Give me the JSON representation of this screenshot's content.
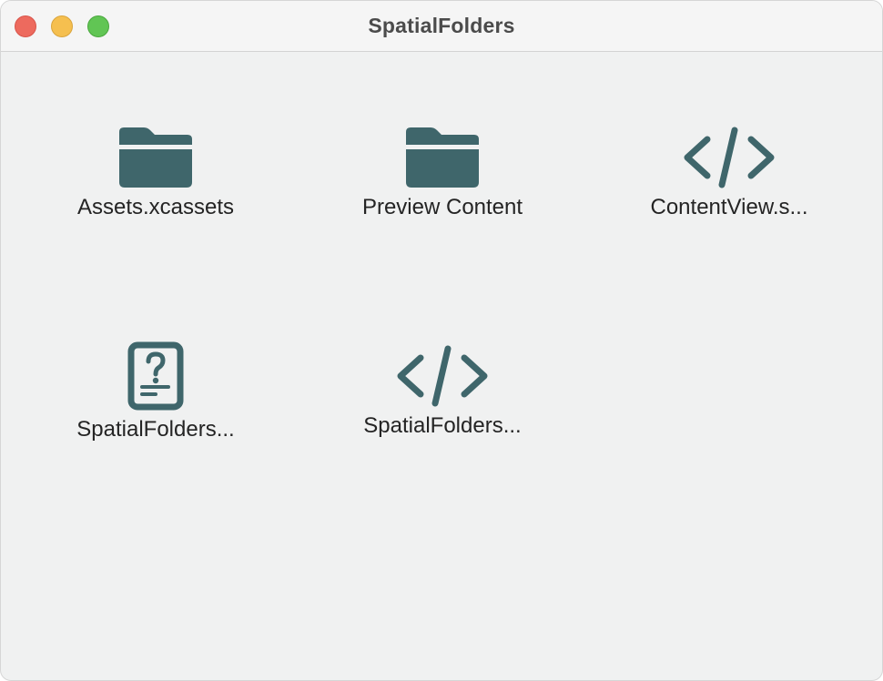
{
  "window": {
    "title": "SpatialFolders"
  },
  "colors": {
    "icon": "#3f666b",
    "background": "#f0f1f1"
  },
  "items": [
    {
      "label": "Assets.xcassets",
      "icon": "folder-icon"
    },
    {
      "label": "Preview Content",
      "icon": "folder-icon"
    },
    {
      "label": "ContentView.s...",
      "icon": "code-file-icon"
    },
    {
      "label": "SpatialFolders...",
      "icon": "unknown-file-icon"
    },
    {
      "label": "SpatialFolders...",
      "icon": "code-file-icon"
    }
  ]
}
